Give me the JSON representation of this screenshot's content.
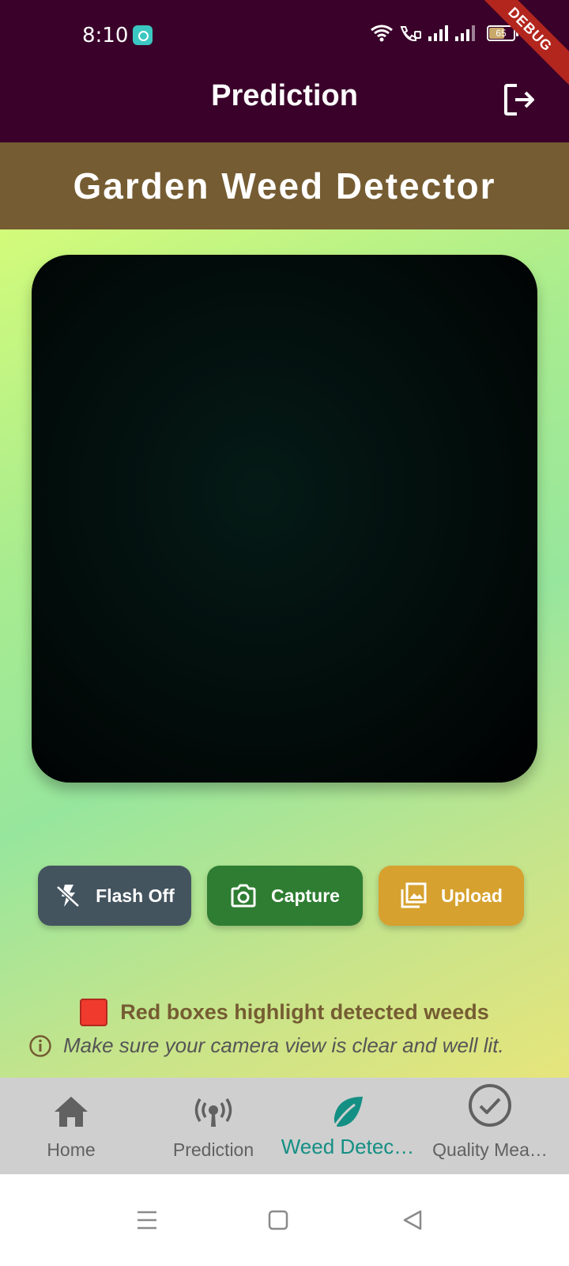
{
  "status_bar": {
    "time": "8:10",
    "battery": "65"
  },
  "debug_label": "DEBUG",
  "app_bar": {
    "title": "Prediction"
  },
  "header": {
    "title": "Garden Weed Detector"
  },
  "actions": {
    "flash_label": "Flash Off",
    "capture_label": "Capture",
    "upload_label": "Upload"
  },
  "legend": {
    "text": "Red boxes highlight detected weeds"
  },
  "tip": {
    "text": "Make sure your camera view is clear and well lit."
  },
  "bottom_nav": {
    "items": [
      {
        "label": "Home",
        "icon": "home-icon"
      },
      {
        "label": "Prediction",
        "icon": "broadcast-icon"
      },
      {
        "label": "Weed Detec…",
        "icon": "leaf-icon"
      },
      {
        "label": "Quality Mea…",
        "icon": "check-circle-icon"
      }
    ],
    "active_index": 2
  },
  "colors": {
    "app_bar": "#3a022a",
    "header_band": "#755c32",
    "flash_button": "#44545f",
    "capture_button": "#2e7d32",
    "upload_button": "#d6a12e",
    "active_nav": "#148f84",
    "weed_marker": "#f03a2e"
  }
}
